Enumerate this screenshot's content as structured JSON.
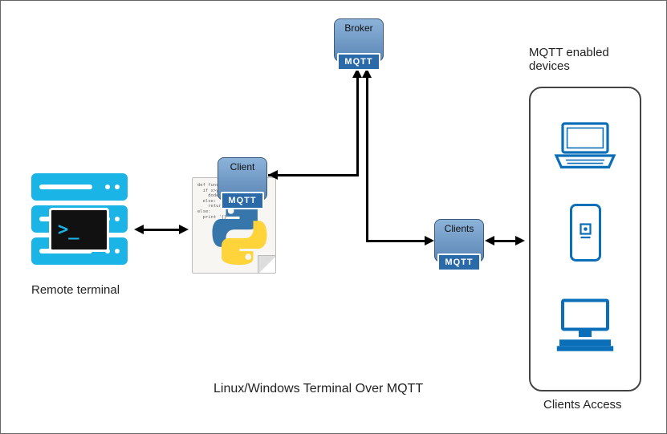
{
  "title": "Linux/Windows Terminal Over MQTT",
  "remote_terminal": {
    "label": "Remote terminal",
    "prompt": ">_"
  },
  "client_box": {
    "label": "Client",
    "badge": "MQTT"
  },
  "broker_box": {
    "label": "Broker",
    "badge": "MQTT"
  },
  "clients_box": {
    "label": "Clients",
    "badge": "MQTT"
  },
  "devices": {
    "header": "MQTT enabled devices",
    "footer": "Clients Access"
  },
  "python_code": "def func1(a,b):\n  if x>y:\n    dodecahedron\n  else:\n    return 'Hi all'\nelse:\n  print '{}'\n"
}
